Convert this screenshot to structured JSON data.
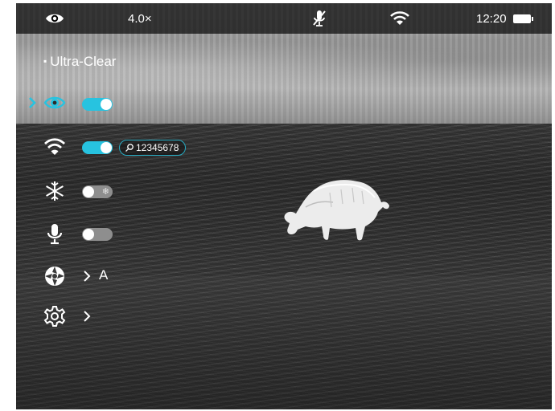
{
  "status_bar": {
    "eye_icon": "eye-icon",
    "zoom": "4.0×",
    "mic_icon": "mic-muted-icon",
    "wifi_icon": "wifi-icon",
    "time": "12:20",
    "battery_icon": "battery-full-icon"
  },
  "menu": {
    "mode_label": "Ultra-Clear",
    "items": [
      {
        "name": "display-mode",
        "icon": "eye-icon",
        "toggle": "on",
        "selected": true
      },
      {
        "name": "wifi",
        "icon": "wifi-icon",
        "toggle": "on",
        "ssid_icon": "search-icon",
        "ssid": "12345678"
      },
      {
        "name": "defrost",
        "icon": "snowflake-icon",
        "toggle": "off",
        "toggle_glyph": "❄"
      },
      {
        "name": "microphone",
        "icon": "mic-icon",
        "toggle": "off"
      },
      {
        "name": "aperture",
        "icon": "aperture-icon",
        "value": "A"
      },
      {
        "name": "settings",
        "icon": "gear-icon"
      }
    ]
  },
  "colors": {
    "accent": "#27c3e0",
    "status_bar_bg": "#000000",
    "toggle_off": "#8e8e8e"
  }
}
